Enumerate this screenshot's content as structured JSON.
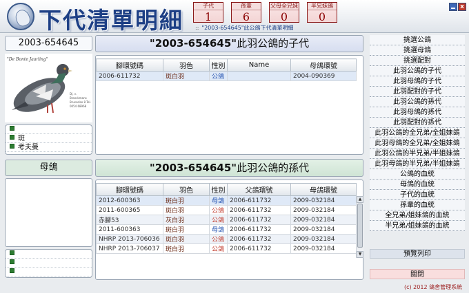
{
  "app": {
    "title": "下代清單明細",
    "subtitle": "\"2003-654645\"此公鴿下代清單明細"
  },
  "stats": [
    {
      "label": "子代",
      "value": "1"
    },
    {
      "label": "孫輩",
      "value": "6"
    },
    {
      "label": "父母全兄妹",
      "value": "0"
    },
    {
      "label": "半兄妹鴿",
      "value": "0"
    }
  ],
  "window": {
    "close_glyph": "x"
  },
  "pigeon": {
    "ring": "2003-654645",
    "photo_caption": "\"De Bonte Jaarling\"",
    "photo_address": "Dj. v. Broeckmans\nBrusselse 8\nTel. 0054 68968",
    "info": [
      "",
      "斑",
      "考夫曼",
      ""
    ]
  },
  "mother_label": "母鴿",
  "mother_info": [
    "",
    "",
    ""
  ],
  "children": {
    "title_ring": "\"2003-654645\"",
    "title_suffix": "此羽公鴿的子代",
    "columns": [
      "腳環號碼",
      "羽色",
      "性別",
      "Name",
      "母鴿環號"
    ],
    "rows": [
      {
        "ring": "2006-611732",
        "color": "斑白羽",
        "sex": "公鴿",
        "name": "",
        "mother": "2004-090369"
      }
    ]
  },
  "grandchildren": {
    "title_ring": "\"2003-654645\"",
    "title_suffix": "此羽公鴿的孫代",
    "columns": [
      "腳環號碼",
      "羽色",
      "性別",
      "父鴿環號",
      "母鴿環號"
    ],
    "rows": [
      {
        "ring": "2012-600363",
        "color": "斑白羽",
        "sex": "母鴿",
        "father": "2006-611732",
        "mother": "2009-032184"
      },
      {
        "ring": "2011-600365",
        "color": "斑白羽",
        "sex": "公鴿",
        "father": "2006-611732",
        "mother": "2009-032184"
      },
      {
        "ring": "赤腳53",
        "color": "灰白羽",
        "sex": "公鴿",
        "father": "2006-611732",
        "mother": "2009-032184"
      },
      {
        "ring": "2011-600363",
        "color": "斑白羽",
        "sex": "母鴿",
        "father": "2006-611732",
        "mother": "2009-032184"
      },
      {
        "ring": "NHRP 2013-706036",
        "color": "斑白羽",
        "sex": "公鴿",
        "father": "2006-611732",
        "mother": "2009-032184"
      },
      {
        "ring": "NHRP 2013-706037",
        "color": "斑白羽",
        "sex": "公鴿",
        "father": "2006-611732",
        "mother": "2009-032184"
      }
    ]
  },
  "menu": {
    "items": [
      "挑選公鴿",
      "挑選母鴿",
      "挑選配對",
      "此羽公鴿的子代",
      "此羽母鴿的子代",
      "此羽配對的子代",
      "此羽公鴿的孫代",
      "此羽母鴿的孫代",
      "此羽配對的孫代",
      "此羽公鴿的全兄弟/全姐妹鴿",
      "此羽母鴿的全兄弟/全姐妹鴿",
      "此羽公鴿的半兄弟/半姐妹鴿",
      "此羽母鴿的半兄弟/半姐妹鴿",
      "公鴿的血統",
      "母鴿的血統",
      "子代的血統",
      "孫輩的血統",
      "全兄弟/姐妹鴿的血統",
      "半兄弟/姐妹鴿的血統"
    ],
    "preview": "預覽列印",
    "close": "關閉"
  },
  "copyright": "(c) 2012 鴿舍管理系統",
  "colors": {
    "title": "#1d3f85",
    "male": "#1f4fb0",
    "female": "#c0392b",
    "child_header": "#d7def0",
    "grand_header": "#d5eadb"
  }
}
